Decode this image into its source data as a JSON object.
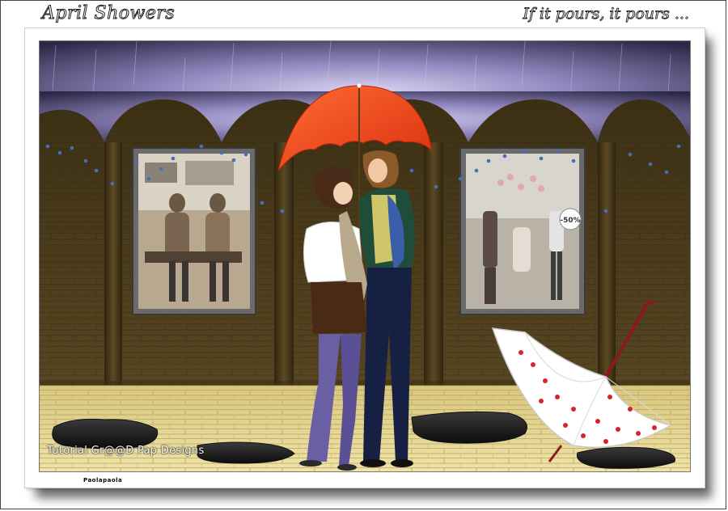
{
  "header": {
    "title": "April Showers",
    "tagline": "If it pours, it pours ..."
  },
  "scene": {
    "sale_sign": "-50%",
    "watermark": "Tutorial Gr@@D Pap Designs",
    "signature": "Paolapaola"
  },
  "colors": {
    "wall": "#4d3e19",
    "pavement": "#e6d692",
    "umbrella_red": "#f04a1a",
    "sky": "#2f2c4e",
    "puddle": "#1d1d1d"
  }
}
